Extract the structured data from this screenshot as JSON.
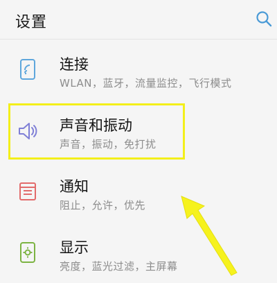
{
  "header": {
    "title": "设置",
    "search_icon": "search-icon"
  },
  "settings": {
    "items": [
      {
        "id": "connection",
        "title": "连接",
        "subtitle": "WLAN，蓝牙，流量监控，飞行模式",
        "icon": "phone-connection-icon",
        "icon_color": "#5ea6dc"
      },
      {
        "id": "sound",
        "title": "声音和振动",
        "subtitle": "声音，振动，免打扰",
        "icon": "speaker-icon",
        "icon_color": "#7f7fd6"
      },
      {
        "id": "notification",
        "title": "通知",
        "subtitle": "阻止，允许，优先",
        "icon": "notification-list-icon",
        "icon_color": "#e26b6b"
      },
      {
        "id": "display",
        "title": "显示",
        "subtitle": "亮度，蓝光过滤，主屏幕",
        "icon": "display-brightness-icon",
        "icon_color": "#7cb342"
      }
    ]
  },
  "annotation": {
    "highlight_color": "#f3ef1a",
    "arrow_color": "#f6f21d"
  }
}
